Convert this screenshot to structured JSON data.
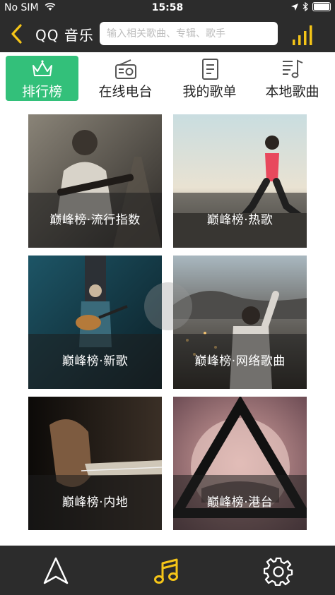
{
  "status_bar": {
    "carrier": "No SIM",
    "time": "15:58"
  },
  "header": {
    "back_icon": "chevron-left-icon",
    "title": "QQ 音乐",
    "search_placeholder": "输入相关歌曲、专辑、歌手",
    "right_icon": "equalizer-bars-icon"
  },
  "tabs": [
    {
      "label": "排行榜",
      "icon": "crown-icon",
      "active": true
    },
    {
      "label": "在线电台",
      "icon": "radio-icon",
      "active": false
    },
    {
      "label": "我的歌单",
      "icon": "document-icon",
      "active": false
    },
    {
      "label": "本地歌曲",
      "icon": "music-list-icon",
      "active": false
    }
  ],
  "charts": [
    {
      "caption": "巅峰榜·流行指数"
    },
    {
      "caption": "巅峰榜·热歌"
    },
    {
      "caption": "巅峰榜·新歌"
    },
    {
      "caption": "巅峰榜·网络歌曲"
    },
    {
      "caption": "巅峰榜·内地"
    },
    {
      "caption": "巅峰榜·港台"
    }
  ],
  "bottom_nav": [
    {
      "icon": "navigation-arrow-icon"
    },
    {
      "icon": "music-note-icon"
    },
    {
      "icon": "gear-icon"
    }
  ],
  "colors": {
    "accent": "#f5c518",
    "active_tab": "#33c07a",
    "bar_bg": "#2c2c2c"
  }
}
